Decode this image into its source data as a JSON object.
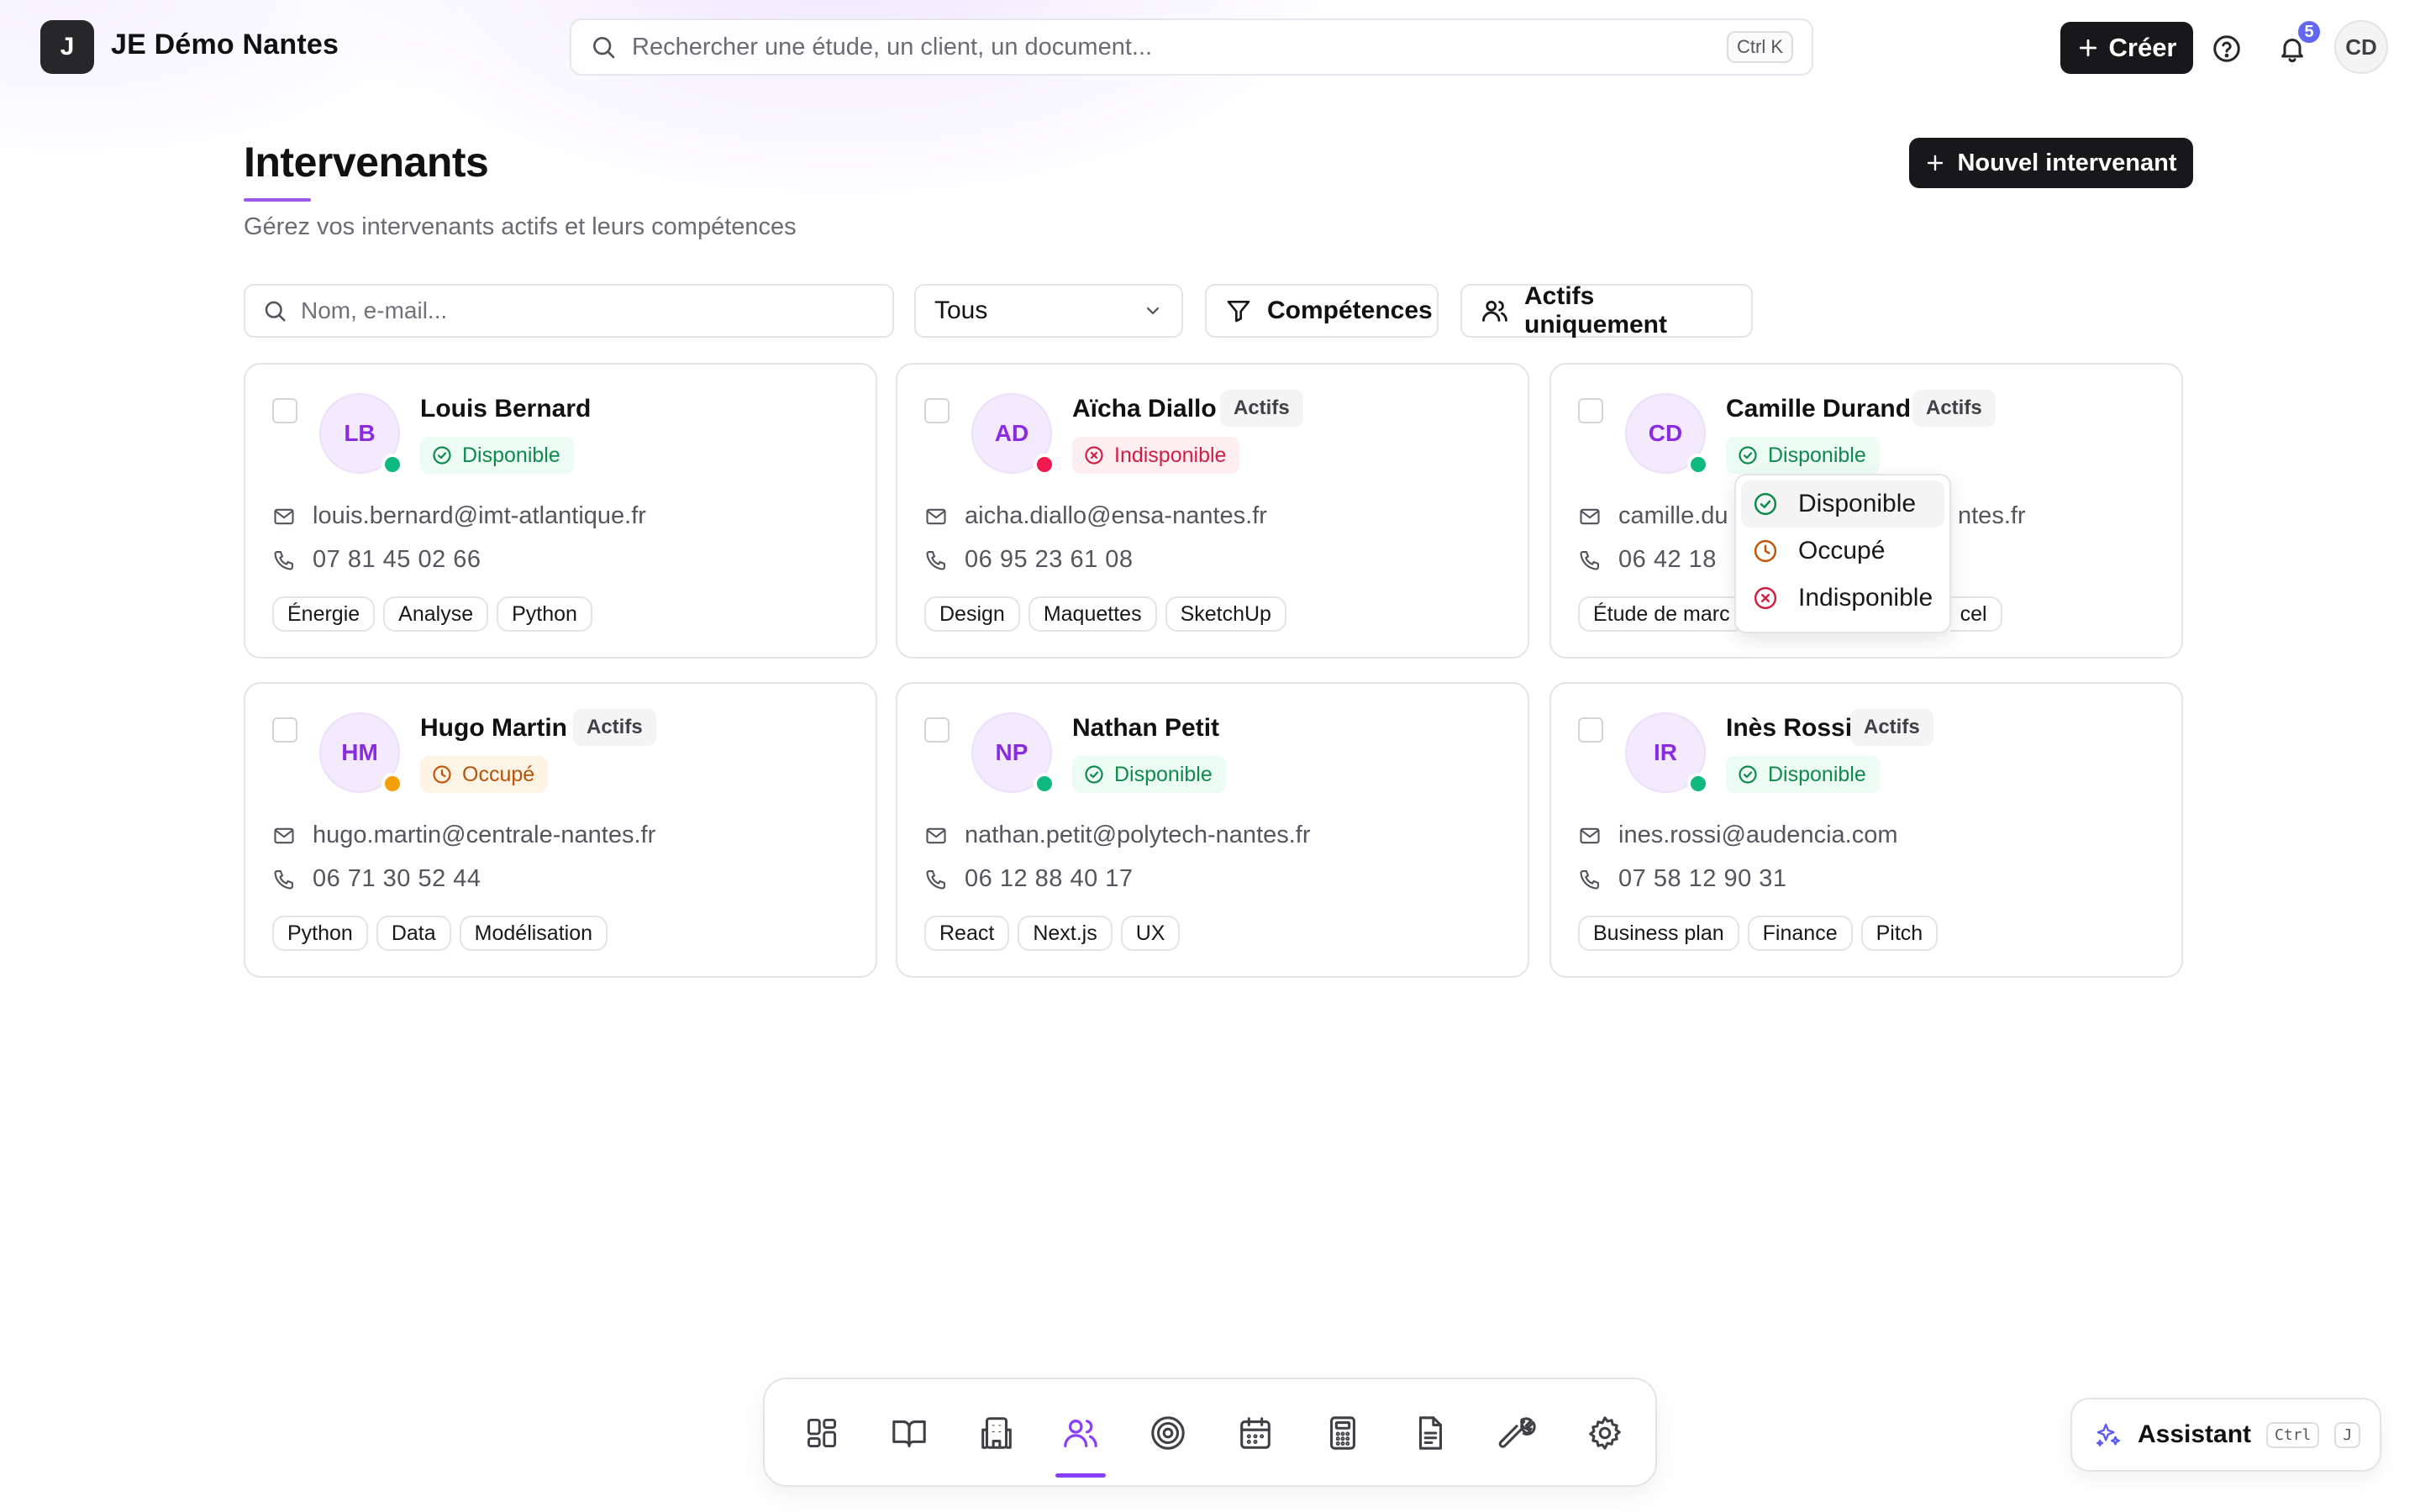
{
  "topbar": {
    "logo_letter": "J",
    "org_name": "JE Démo Nantes",
    "search_placeholder": "Rechercher une étude, un client, un document...",
    "search_shortcut": "Ctrl K",
    "create_label": "Créer",
    "notification_count": "5",
    "user_initials": "CD"
  },
  "header": {
    "title": "Intervenants",
    "subtitle": "Gérez vos intervenants actifs et leurs compétences",
    "new_button": "Nouvel intervenant"
  },
  "filters": {
    "search_placeholder": "Nom, e-mail...",
    "select_value": "Tous",
    "skills_label": "Compétences",
    "active_label": "Actifs uniquement"
  },
  "colors": {
    "accent": "#8a3ffc",
    "available": "#10b981",
    "unavailable": "#f0194f",
    "busy": "#f59e0b",
    "primary_button": "#18181b"
  },
  "cards": [
    {
      "initials": "LB",
      "name": "Louis Bernard",
      "badge": "",
      "status": "Disponible",
      "status_kind": "ok",
      "email": "louis.bernard@imt-atlantique.fr",
      "phone": "07 81 45 02 66",
      "tags": [
        "Énergie",
        "Analyse",
        "Python"
      ]
    },
    {
      "initials": "AD",
      "name": "Aïcha Diallo",
      "badge": "Actifs",
      "status": "Indisponible",
      "status_kind": "ko",
      "email": "aicha.diallo@ensa-nantes.fr",
      "phone": "06 95 23 61 08",
      "tags": [
        "Design",
        "Maquettes",
        "SketchUp"
      ]
    },
    {
      "initials": "CD",
      "name": "Camille Durand",
      "badge": "Actifs",
      "status": "Disponible",
      "status_kind": "ok",
      "email": "camille.du",
      "email_tail": "ntes.fr",
      "phone": "06 42 18",
      "tags": [
        "Étude de marc",
        "cel"
      ]
    },
    {
      "initials": "HM",
      "name": "Hugo Martin",
      "badge": "Actifs",
      "status": "Occupé",
      "status_kind": "busy",
      "email": "hugo.martin@centrale-nantes.fr",
      "phone": "06 71 30 52 44",
      "tags": [
        "Python",
        "Data",
        "Modélisation"
      ]
    },
    {
      "initials": "NP",
      "name": "Nathan Petit",
      "badge": "",
      "status": "Disponible",
      "status_kind": "ok",
      "email": "nathan.petit@polytech-nantes.fr",
      "phone": "06 12 88 40 17",
      "tags": [
        "React",
        "Next.js",
        "UX"
      ]
    },
    {
      "initials": "IR",
      "name": "Inès Rossi",
      "badge": "Actifs",
      "status": "Disponible",
      "status_kind": "ok",
      "email": "ines.rossi@audencia.com",
      "phone": "07 58 12 90 31",
      "tags": [
        "Business plan",
        "Finance",
        "Pitch"
      ]
    }
  ],
  "status_menu": {
    "options": [
      "Disponible",
      "Occupé",
      "Indisponible"
    ],
    "highlighted": "Disponible"
  },
  "dock": {
    "items": [
      "dashboard-icon",
      "book-icon",
      "building-icon",
      "users-icon",
      "target-icon",
      "calendar-icon",
      "calculator-icon",
      "document-icon",
      "wrench-icon",
      "settings-icon"
    ],
    "active": "users-icon"
  },
  "assistant": {
    "label": "Assistant",
    "key1": "Ctrl",
    "key2": "J"
  }
}
